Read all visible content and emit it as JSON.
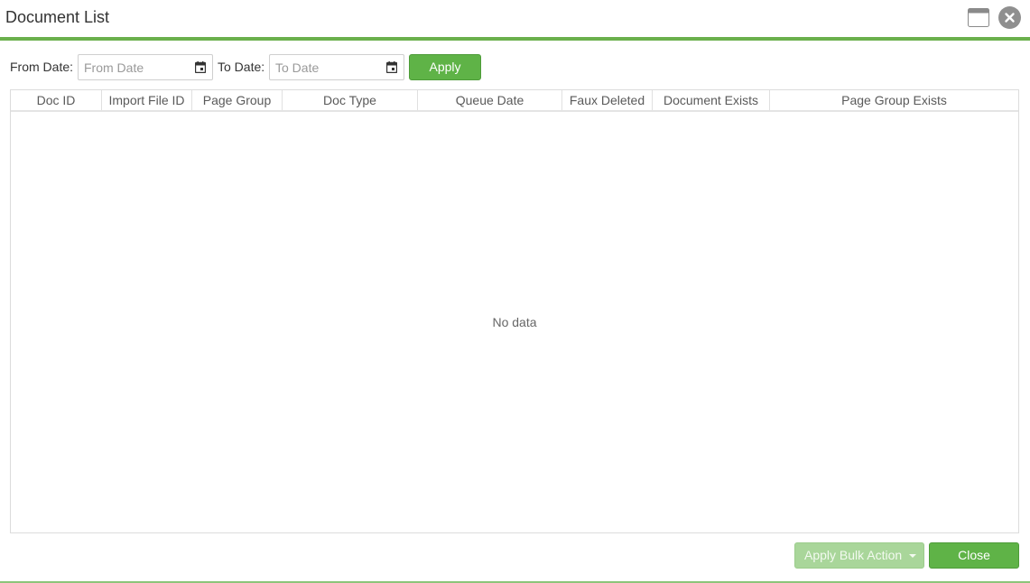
{
  "window": {
    "title": "Document List",
    "accent_color": "#6ab04c"
  },
  "filters": {
    "from_label": "From Date:",
    "from_placeholder": "From Date",
    "to_label": "To Date:",
    "to_placeholder": "To Date",
    "apply_label": "Apply"
  },
  "grid": {
    "columns": [
      "Doc ID",
      "Import File ID",
      "Page Group",
      "Doc Type",
      "Queue Date",
      "Faux Deleted",
      "Document Exists",
      "Page Group Exists"
    ],
    "rows": [],
    "empty_text": "No data"
  },
  "footer": {
    "bulk_action_label": "Apply Bulk Action",
    "close_label": "Close"
  },
  "icons": {
    "maximize": "maximize-icon",
    "close": "close-icon",
    "calendar": "calendar-icon",
    "dropdown": "chevron-down-icon"
  }
}
